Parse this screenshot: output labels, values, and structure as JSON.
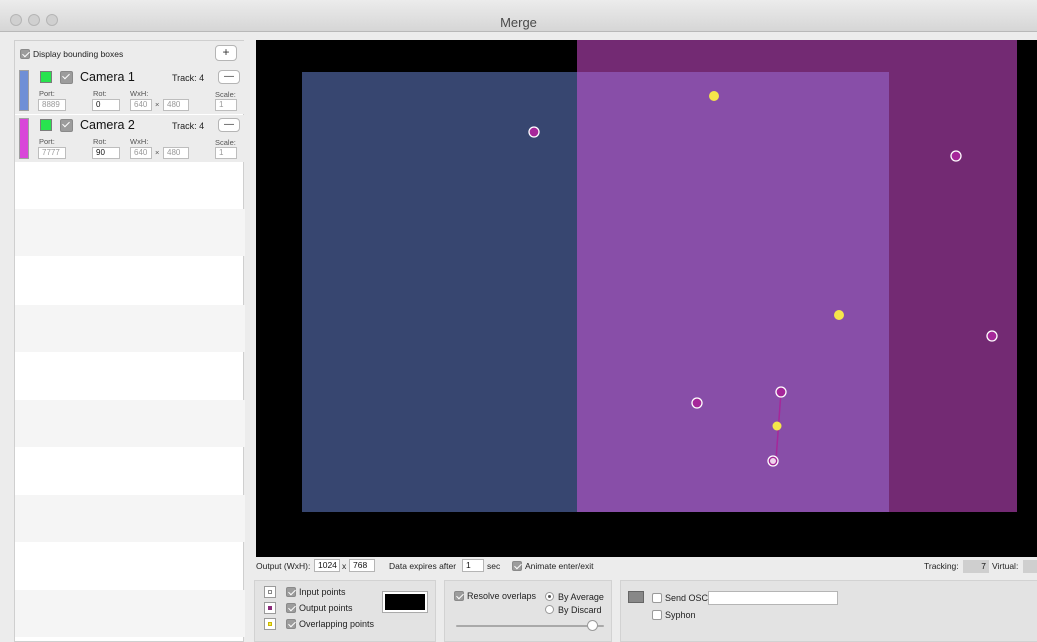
{
  "window": {
    "title": "Merge"
  },
  "sidebar": {
    "display_bounding_boxes_label": "Display bounding boxes",
    "display_bounding_boxes_checked": true,
    "add_button": "+",
    "cameras": [
      {
        "name": "Camera 1",
        "track_label": "Track: 4",
        "remove_button": "—",
        "port_label": "Port:",
        "port": "8889",
        "rot_label": "Rot:",
        "rot": "0",
        "wxh_label": "WxH:",
        "width": "640",
        "times": "×",
        "height": "480",
        "scale_label": "Scale:",
        "scale": "1",
        "color": "#6f8fd6"
      },
      {
        "name": "Camera 2",
        "track_label": "Track: 4",
        "remove_button": "—",
        "port_label": "Port:",
        "port": "7777",
        "rot_label": "Rot:",
        "rot": "90",
        "wxh_label": "WxH:",
        "width": "640",
        "times": "×",
        "height": "480",
        "scale_label": "Scale:",
        "scale": "1",
        "color": "#d946d9"
      }
    ]
  },
  "canvas": {
    "colors": {
      "camera1_box": "#374670",
      "camera2_box": "#732a73",
      "overlap": "#884ea8",
      "input_point": "#ffffff",
      "output_point": "#a6279a",
      "overlap_point": "#f5e64a"
    }
  },
  "output_bar": {
    "output_label": "Output (WxH):",
    "width": "1024",
    "x": "x",
    "height": "768",
    "expires_label": "Data expires after",
    "expires_value": "1",
    "sec_label": "sec",
    "animate_label": "Animate enter/exit",
    "animate_checked": true,
    "tracking_label": "Tracking:",
    "tracking_value": "7",
    "virtual_label": "Virtual:"
  },
  "legend": {
    "input_points": "Input points",
    "output_points": "Output points",
    "overlapping_points": "Overlapping points"
  },
  "overlap_panel": {
    "resolve_label": "Resolve overlaps",
    "by_average": "By Average",
    "by_discard": "By Discard",
    "slider_value": 0.92
  },
  "osc_panel": {
    "send_osc": "Send OSC",
    "syphon": "Syphon"
  }
}
